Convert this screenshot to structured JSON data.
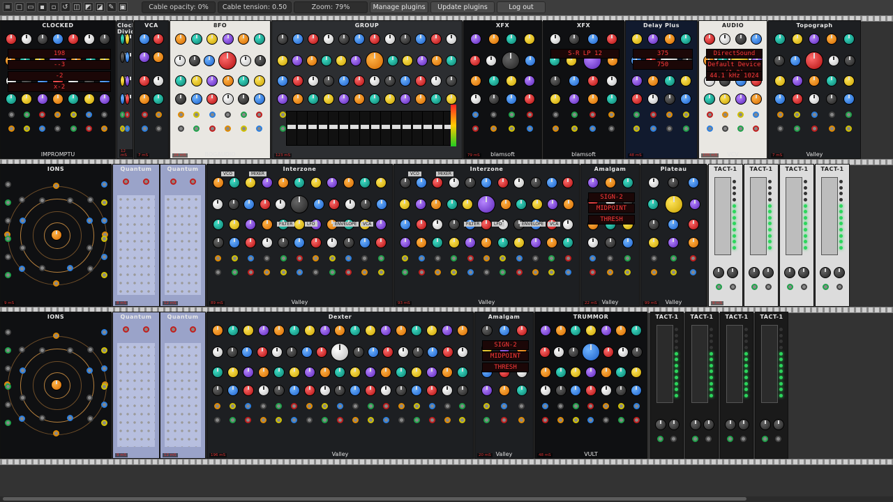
{
  "toolbar": {
    "icons": [
      {
        "name": "menu-icon",
        "glyph": "≡"
      },
      {
        "name": "new-patch-icon",
        "glyph": "□"
      },
      {
        "name": "open-patch-icon",
        "glyph": "▭"
      },
      {
        "name": "save-icon",
        "glyph": "▪"
      },
      {
        "name": "save-as-icon",
        "glyph": "▫"
      },
      {
        "name": "revert-icon",
        "glyph": "↺"
      },
      {
        "name": "disconnect-icon",
        "glyph": "◫"
      },
      {
        "name": "power-meter-icon",
        "glyph": "◩"
      },
      {
        "name": "cpu-icon",
        "glyph": "◪"
      },
      {
        "name": "plug-icon",
        "glyph": "✎"
      },
      {
        "name": "lock-icon",
        "glyph": "▣"
      }
    ],
    "cable_opacity": "Cable opacity: 0%",
    "cable_tension": "Cable tension: 0.50",
    "zoom": "Zoom: 79%",
    "manage_plugins": "Manage plugins",
    "update_plugins": "Update plugins",
    "logout": "Log out"
  },
  "rows": {
    "row1": [
      {
        "id": "clocked",
        "title": "CLOCKED",
        "footer": "IMPROMPTU",
        "style": "black",
        "badge": "",
        "lcd": [
          "198",
          "--3",
          "-2",
          "x-2"
        ],
        "labels": [
          "RESET",
          "RUN",
          "BPM",
          "SWING",
          "RATIO",
          "SWING 1",
          "PW 1",
          "DELAY 1",
          "SWING 2",
          "PW 2",
          "DELAY 2",
          "SWING 3",
          "PW 3",
          "DELAY 3",
          "RESET",
          "RUN",
          "BPM",
          "CLK",
          "CLK 1",
          "CLK 2",
          "CLK 3"
        ]
      },
      {
        "id": "clock-divider",
        "title": "Clock Divider",
        "footer": "",
        "style": "grey",
        "badge": "12 mS"
      },
      {
        "id": "vca",
        "title": "VCA",
        "footer": "",
        "style": "dark",
        "badge": "7 mS",
        "labels": [
          "LVL",
          "LVL",
          "LIN",
          "EXP",
          "OUT"
        ]
      },
      {
        "id": "8fo",
        "title": "8FO",
        "footer": "BOGAUDIO",
        "style": "white",
        "badge": "24 mS",
        "labels": [
          "0.5 - 7HZ",
          "0.1",
          "400HZ",
          "SAM/PW",
          "OFFSET",
          "SCALE",
          "DBL",
          "SQR",
          "SLOW",
          "V/OCT",
          "RESET"
        ]
      },
      {
        "id": "mschack",
        "title": "GROUP",
        "footer": "",
        "style": "grey",
        "badge": "123 mS",
        "labels": [
          "Input",
          "AUX Send",
          "EQ",
          "Pre Fader",
          "Level CV",
          "Pan CV",
          "Pan",
          "Mute",
          "Group Route",
          "AUX RETURN",
          "MSCHACK"
        ]
      },
      {
        "id": "xfx-reverb",
        "title": "XFX",
        "footer": "blamsoft",
        "style": "black",
        "badge": "79 mS",
        "labels": [
          "REVERB",
          "ENABLE",
          "TIME",
          "MID",
          "LOW",
          "X-OVER",
          "DAMP",
          "MIX",
          "M.RATE",
          "DELAY",
          "M.AMT",
          "IN",
          "OUT"
        ]
      },
      {
        "id": "xfx-f35",
        "title": "XFX",
        "footer": "blamsoft",
        "style": "black",
        "badge": "",
        "lcd": [
          "S-R LP 12"
        ],
        "labels": [
          "F-35",
          "DRIVE",
          "FREQ",
          "RES",
          "MODE",
          "MIX",
          "IN",
          "OUT"
        ]
      },
      {
        "id": "delay-plus",
        "title": "Delay Plus",
        "footer": "",
        "style": "navy",
        "badge": "48 mS",
        "lcd": [
          "375",
          "750"
        ],
        "labels": [
          "STEREO FX",
          "FDBK",
          "CLR",
          "MIX",
          "BYPASS"
        ]
      },
      {
        "id": "audio",
        "title": "AUDIO",
        "footer": "VCV",
        "style": "white",
        "badge": "105 mS",
        "lcd": [
          "DirectSound",
          "Default Device (1-2)",
          "44.1 kHz  1024"
        ],
        "labels": [
          "INPUTS",
          "OUTPUTS"
        ]
      },
      {
        "id": "topograph",
        "title": "Topograph",
        "footer": "Valley",
        "style": "dark",
        "badge": "7 mS",
        "labels": [
          "Clock",
          "Ext",
          "Swing",
          "Reset",
          "Run",
          "Map X",
          "Map Y",
          "Chaos",
          "Trig",
          "Acc",
          "Fill"
        ]
      }
    ],
    "row2": [
      {
        "id": "ions-1",
        "title": "IONS",
        "footer": "",
        "style": "black",
        "badge": "9 mS",
        "labels": [
          "ATOMIC DUAL CV SEQUENCER"
        ]
      },
      {
        "id": "quantum-1",
        "title": "Quantum",
        "footer": "",
        "style": "lilac",
        "badge": "8 mS",
        "labels": [
          "In",
          "Out",
          "Trans",
          "Gate",
          "Trigger",
          "Note",
          "Toggle",
          "Reset"
        ]
      },
      {
        "id": "quantum-2",
        "title": "Quantum",
        "footer": "",
        "style": "lilac",
        "badge": "12 mS",
        "labels": [
          "In",
          "Out",
          "Trans",
          "Gate",
          "Trigger",
          "Note",
          "Toggle",
          "Reset"
        ]
      },
      {
        "id": "interzone-1",
        "title": "Interzone",
        "footer": "Valley",
        "style": "dark",
        "badge": "89 mS",
        "labels": [
          "VCO",
          "MIXER",
          "FILTER",
          "LFO",
          "ENVELOPE",
          "VCA",
          "Semi",
          "Fine",
          "Octave",
          "Coarse",
          "Width",
          "PWM",
          "Glide",
          "Mod",
          "Sub",
          "Saw",
          "Pulse",
          "Noise Ext",
          "Freq",
          "Res",
          "HPF",
          "2P",
          "Env",
          "LFO",
          "V/Oct",
          "Rate",
          "Slow",
          "Wave",
          "Long",
          "Short",
          "Cycle",
          "Manual",
          "Gate",
          "A",
          "D",
          "S",
          "R",
          "Gain"
        ]
      },
      {
        "id": "interzone-2",
        "title": "Interzone",
        "footer": "Valley",
        "style": "dark",
        "badge": "93 mS",
        "labels": [
          "VCO",
          "MIXER",
          "FILTER",
          "LFO",
          "ENVELOPE",
          "VCA"
        ]
      },
      {
        "id": "amalgam-1",
        "title": "Amalgam",
        "footer": "Valley",
        "style": "dark",
        "badge": "22 mS",
        "lcd": [
          "SIGN-2",
          "MIDPOINT",
          "THRESH"
        ],
        "labels": [
          "Gain",
          "Type",
          "Param A",
          "Param B",
          "DC",
          "X",
          "Y",
          "L",
          "R"
        ]
      },
      {
        "id": "plateau",
        "title": "Plateau",
        "footer": "Valley",
        "style": "dark",
        "badge": "99 mS",
        "labels": [
          "Dry",
          "Wet",
          "Pre Dly",
          "Input Filter",
          "Low",
          "High",
          "Size",
          "Diffuse",
          "Decay",
          "Reverb Filter",
          "Mod Rate",
          "Mod Shape",
          "Mod Depth",
          "Hold",
          "Clear",
          "Tuned Mode",
          "Diffuse Input",
          "L Out R"
        ]
      },
      {
        "id": "tact-1",
        "title": "TACT-1",
        "footer": "",
        "style": "tact",
        "badge": "9 mS",
        "labels": [
          "RATE",
          "ATTV",
          "CV",
          "EXP"
        ]
      },
      {
        "id": "tact-2",
        "title": "TACT-1",
        "footer": "",
        "style": "tact",
        "badge": "",
        "labels": [
          "RATE",
          "ATTV",
          "CV",
          "EXP"
        ]
      },
      {
        "id": "tact-3",
        "title": "TACT-1",
        "footer": "",
        "style": "tact",
        "badge": "",
        "labels": [
          "RATE",
          "ATTV",
          "CV",
          "EXP"
        ]
      },
      {
        "id": "tact-4",
        "title": "TACT-1",
        "footer": "",
        "style": "tact",
        "badge": "",
        "labels": [
          "RATE",
          "ATTV",
          "CV",
          "EXP"
        ]
      }
    ],
    "row3": [
      {
        "id": "ions-2",
        "title": "IONS",
        "footer": "",
        "style": "black",
        "badge": "",
        "labels": [
          "ATOMIC DUAL CV SEQUENCER"
        ]
      },
      {
        "id": "quantum-3",
        "title": "Quantum",
        "footer": "",
        "style": "lilac",
        "badge": "9 mS",
        "labels": [
          "In",
          "Out",
          "Trans",
          "Gate",
          "Trigger",
          "Note",
          "Toggle",
          "Reset"
        ]
      },
      {
        "id": "quantum-4",
        "title": "Quantum",
        "footer": "",
        "style": "lilac",
        "badge": "12 mS",
        "labels": [
          "In",
          "Out",
          "Trans",
          "Gate",
          "Trigger",
          "Note",
          "Toggle",
          "Reset"
        ]
      },
      {
        "id": "dexter",
        "title": "Dexter",
        "footer": "Valley",
        "style": "dark",
        "badge": "196 mS",
        "labels": [
          "Master Controls",
          "Algo.",
          "Oct. 2",
          "Coarse",
          "Fine",
          "Chord",
          "Invert",
          "Detune",
          "Full Inversion",
          "Oct. 0",
          "LFO",
          "Reset Phase",
          "Shape",
          "Bright",
          "FB",
          "Operator",
          "Mul. 1",
          "Wave",
          "Shape",
          "Level",
          "Pre Fade",
          "Weak",
          "Sync",
          "Mod 1",
          "Mod 2",
          "Mod 3",
          "Mod 4",
          "Pitch"
        ]
      },
      {
        "id": "amalgam-2",
        "title": "Amalgam",
        "footer": "Valley",
        "style": "dark",
        "badge": "20 mS",
        "lcd": [
          "SIGN-2",
          "MIDPOINT",
          "THRESH"
        ],
        "labels": [
          "Gain",
          "Type",
          "Param A",
          "Param B"
        ]
      },
      {
        "id": "trummor",
        "title": "TRUMMOR",
        "footer": "VULT",
        "style": "black",
        "badge": "48 mS",
        "labels": [
          "drum synthesizer",
          "OSCILLATOR",
          "NOISE",
          "TUNE",
          "BEND",
          "DRIVE",
          "PITCH",
          "BEND",
          "RESCOMB",
          "DECAY",
          "ATTACK",
          "HOLD",
          "LEVEL",
          "SOURCE",
          "GATE",
          "OUTPUT"
        ]
      },
      {
        "id": "tact-5",
        "title": "TACT-1",
        "footer": "",
        "style": "tactd",
        "badge": "",
        "labels": [
          "RATE",
          "ATTV",
          "CV",
          "EXP"
        ]
      },
      {
        "id": "tact-6",
        "title": "TACT-1",
        "footer": "",
        "style": "tactd",
        "badge": "",
        "labels": [
          "RATE",
          "ATTV",
          "CV",
          "EXP"
        ]
      },
      {
        "id": "tact-7",
        "title": "TACT-1",
        "footer": "",
        "style": "tactd",
        "badge": "",
        "labels": [
          "RATE",
          "ATTV",
          "CV",
          "EXP"
        ]
      },
      {
        "id": "tact-8",
        "title": "TACT-1",
        "footer": "",
        "style": "tactd",
        "badge": "",
        "labels": [
          "RATE",
          "ATTV",
          "CV",
          "EXP"
        ]
      }
    ]
  },
  "colors": {
    "rail": "#bfbfbf",
    "rack": "#333333",
    "toolbar": "#3d3d3d",
    "accent_orange": "#ff9b1f",
    "accent_red": "#e02020",
    "accent_green": "#2cd65c",
    "accent_blue": "#2b7fe0"
  }
}
